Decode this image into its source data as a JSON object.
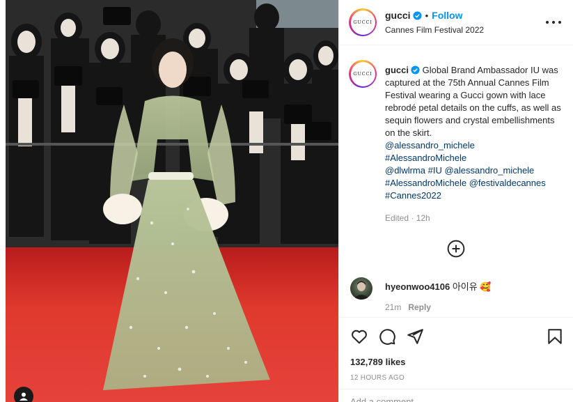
{
  "post": {
    "account": {
      "username": "gucci",
      "avatar_logo_text": "GUCCI",
      "verified": true
    },
    "follow_label": "Follow",
    "separator": "•",
    "location": "Cannes Film Festival 2022",
    "caption": {
      "text": "Global Brand Ambassador IU was captured at the 75th Annual Cannes Film Festival wearing a Gucci gown with lace rebrodé petal details on the cuffs, as well as sequin flowers and crystal embellishments on the skirt.",
      "tag_1": "@alessandro_michele",
      "tag_2": "#AlessandroMichele",
      "tag_3": "@dlwlrma",
      "tag_4": "#IU",
      "tag_5": "@alessandro_michele",
      "tag_6": "#AlessandroMichele",
      "tag_7": "@festivaldecannes",
      "tag_8": "#Cannes2022",
      "meta": "Edited · 12h"
    },
    "comment": {
      "username": "hyeonwoo4106",
      "text": "아이유 🥰",
      "time": "21m",
      "reply_label": "Reply"
    },
    "likes": "132,789 likes",
    "posted_ago": "12 HOURS AGO",
    "add_comment_placeholder": "Add a comment..."
  },
  "colors": {
    "accent": "#0095f6",
    "hashtag": "#00376b",
    "muted": "#8e8e8e",
    "carpet": "#d9302a"
  },
  "icons": [
    "verified-badge-icon",
    "more-options-icon",
    "load-more-plus-icon",
    "heart-icon",
    "comment-icon",
    "share-icon",
    "bookmark-icon"
  ]
}
